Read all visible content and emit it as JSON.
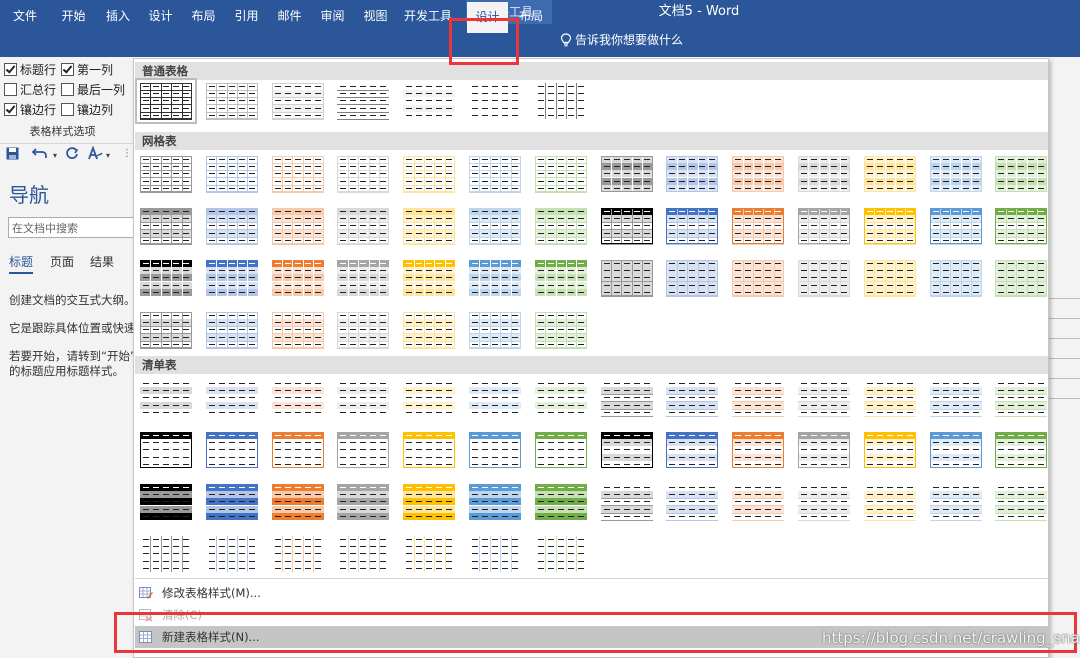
{
  "title_bar": {
    "context_group": "表格工具",
    "document_title": "文档5 - Word"
  },
  "ribbon": {
    "tabs": [
      "文件",
      "开始",
      "插入",
      "设计",
      "布局",
      "引用",
      "邮件",
      "审阅",
      "视图",
      "开发工具",
      "设计",
      "布局"
    ],
    "active_tab": "设计",
    "tell_me": "告诉我你想要做什么"
  },
  "table_style_options": {
    "checkboxes": [
      {
        "label": "标题行",
        "checked": true
      },
      {
        "label": "第一列",
        "checked": true
      },
      {
        "label": "汇总行",
        "checked": false
      },
      {
        "label": "最后一列",
        "checked": false
      },
      {
        "label": "镶边行",
        "checked": true
      },
      {
        "label": "镶边列",
        "checked": false
      }
    ],
    "group_label": "表格样式选项"
  },
  "quick_access": {
    "save_icon": "save-icon",
    "undo_icon": "undo-icon",
    "redo_icon": "redo-icon",
    "format_icon": "format-painter-icon"
  },
  "navigation": {
    "title": "导航",
    "search_placeholder": "在文档中搜索",
    "tabs": [
      "标题",
      "页面",
      "结果"
    ],
    "active_tab": "标题",
    "text_lines": [
      "创建文档的交互式大纲。",
      "它是跟踪具体位置或快速",
      "若要开始，请转到“开始”选",
      "的标题应用标题样式。"
    ]
  },
  "gallery": {
    "sections": [
      {
        "title": "普通表格",
        "rows": 1,
        "count": 7
      },
      {
        "title": "网格表",
        "rows": 4,
        "count": 49
      },
      {
        "title": "清单表",
        "rows": 4,
        "count": 49
      }
    ],
    "accent_colors": [
      "#000000",
      "#4472c4",
      "#ed7d31",
      "#a5a5a5",
      "#ffc000",
      "#5b9bd5",
      "#70ad47"
    ],
    "menu": [
      {
        "label": "修改表格样式(M)...",
        "state": "normal"
      },
      {
        "label": "清除(C)",
        "state": "disabled"
      },
      {
        "label": "新建表格样式(N)...",
        "state": "hover"
      }
    ]
  },
  "watermark": "https://blog.csdn.net/crawling_snail"
}
